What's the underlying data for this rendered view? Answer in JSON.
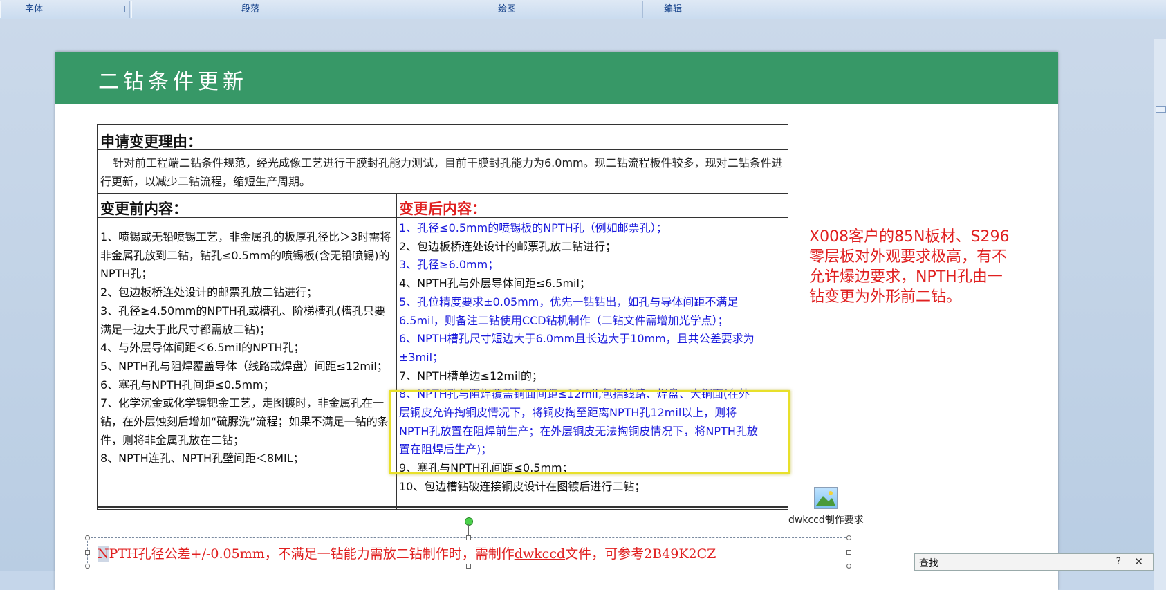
{
  "ribbon": {
    "groups": [
      "字体",
      "段落",
      "绘图",
      "编辑"
    ]
  },
  "slide": {
    "title": "二钻条件更新",
    "reason_header": "申请变更理由：",
    "reason_text": "针对前工程端二钻条件规范，经光成像工艺进行干膜封孔能力测试，目前干膜封孔能力为6.0mm。现二钻流程板件较多，现对二钻条件进行更新，以减少二钻流程，缩短生产周期。",
    "before_header": "变更前内容：",
    "after_header": "变更后内容：",
    "before_items": [
      "1、喷锡或无铅喷锡工艺，非金属孔的板厚孔径比＞3时需将非金属孔放到二钻，钻孔≤0.5mm的喷锡板(含无铅喷锡)的NPTH孔；",
      "2、包边板桥连处设计的邮票孔放二钻进行；",
      "3、孔径≥4.50mm的NPTH孔或槽孔、阶梯槽孔(槽孔只要满足一边大于此尺寸都需放二钻)；",
      "4、与外层导体间距＜6.5mil的NPTH孔；",
      "5、NPTH孔与阻焊覆盖导体（线路或焊盘）间距≤12mil；",
      "6、塞孔与NPTH孔间距≤0.5mm；",
      "7、化学沉金或化学镍钯金工艺，走图镀时，非金属孔在一钻，在外层蚀刻后增加“硫脲洗”流程；如果不满足一钻的条件，则将非金属孔放在二钻；",
      "8、NPTH连孔、NPTH孔壁间距＜8MIL；"
    ],
    "after_items": [
      {
        "text": "1、孔径≤0.5mm的喷锡板的NPTH孔（例如邮票孔）；",
        "color": "blue"
      },
      {
        "text": "2、包边板桥连处设计的邮票孔放二钻进行；",
        "color": "black"
      },
      {
        "text": "3、孔径≥6.0mm；",
        "color": "blue"
      },
      {
        "text": "4、NPTH孔与外层导体间距≤6.5mil；",
        "color": "black"
      },
      {
        "text": "5、孔位精度要求±0.05mm，优先一钻钻出，如孔与导体间距不满足6.5mil，则备注二钻使用CCD钻机制作（二钻文件需增加光学点）；",
        "color": "blue"
      },
      {
        "text": "6、NPTH槽孔尺寸短边大于6.0mm且长边大于10mm，且共公差要求为±3mil；",
        "color": "blue"
      },
      {
        "text": "7、NPTH槽单边≤12mil的；",
        "color": "black"
      },
      {
        "text": "8、NPTH孔与阻焊覆盖铜面间距≤12mil,包括线路、焊盘、大铜面(在外层铜皮允许掏铜皮情况下，将铜皮掏至距离NPTH孔12mil以上，则将NPTH孔放置在阻焊前生产；在外层铜皮无法掏铜皮情况下，将NPTH孔放置在阻焊后生产)；",
        "color": "blue"
      },
      {
        "text": "9、塞孔与NPTH孔间距≤0.5mm；",
        "color": "black"
      },
      {
        "text": "10、包边槽钻破连接铜皮设计在图镀后进行二钻；",
        "color": "black"
      }
    ],
    "side_note": "X008客户的85N板材、S296零层板对外观要求极高，有不允许爆边要求，NPTH孔由一钻变更为外形前二钻。",
    "textbox": {
      "selected": "N",
      "part1": "PTH孔径公差+/-0.05mm，不满足一钻能力需放二钻制作时，需制作",
      "link": "dwkccd",
      "part2": "文件，可参考2B49K2CZ"
    },
    "object_label": "dwkccd制作要求"
  },
  "find": {
    "label": "查找",
    "help": "?",
    "close": "✕"
  },
  "colors": {
    "banner": "#379867",
    "blue_text": "#1a1adc",
    "red_text": "#e02020",
    "highlight": "#e8e02a"
  }
}
